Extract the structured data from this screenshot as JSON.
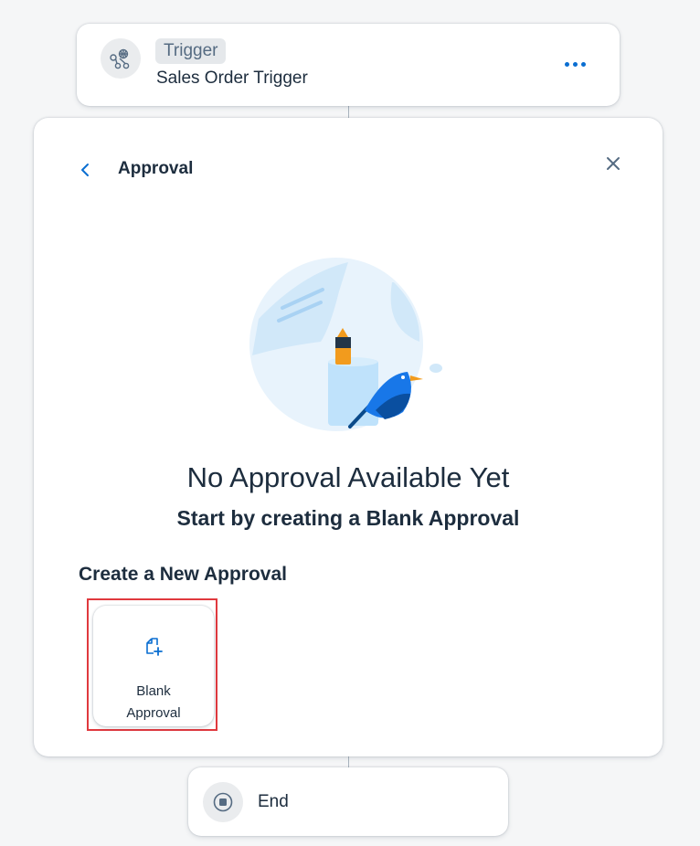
{
  "trigger": {
    "badge": "Trigger",
    "name": "Sales Order Trigger",
    "icon": "workflow-network-icon",
    "more_icon": "more-options-icon"
  },
  "panel": {
    "title": "Approval",
    "back_icon": "chevron-left-icon",
    "close_icon": "close-icon",
    "empty_title": "No Approval Available Yet",
    "empty_subtitle": "Start by creating a Blank Approval",
    "section_heading": "Create a New Approval",
    "options": [
      {
        "label_line1": "Blank",
        "label_line2": "Approval",
        "icon": "add-document-icon"
      }
    ]
  },
  "end": {
    "label": "End",
    "icon": "stop-icon"
  },
  "colors": {
    "accent": "#0a6ed1",
    "highlight_border": "#e0393e",
    "text": "#1d2d3e",
    "background": "#f5f6f7"
  }
}
